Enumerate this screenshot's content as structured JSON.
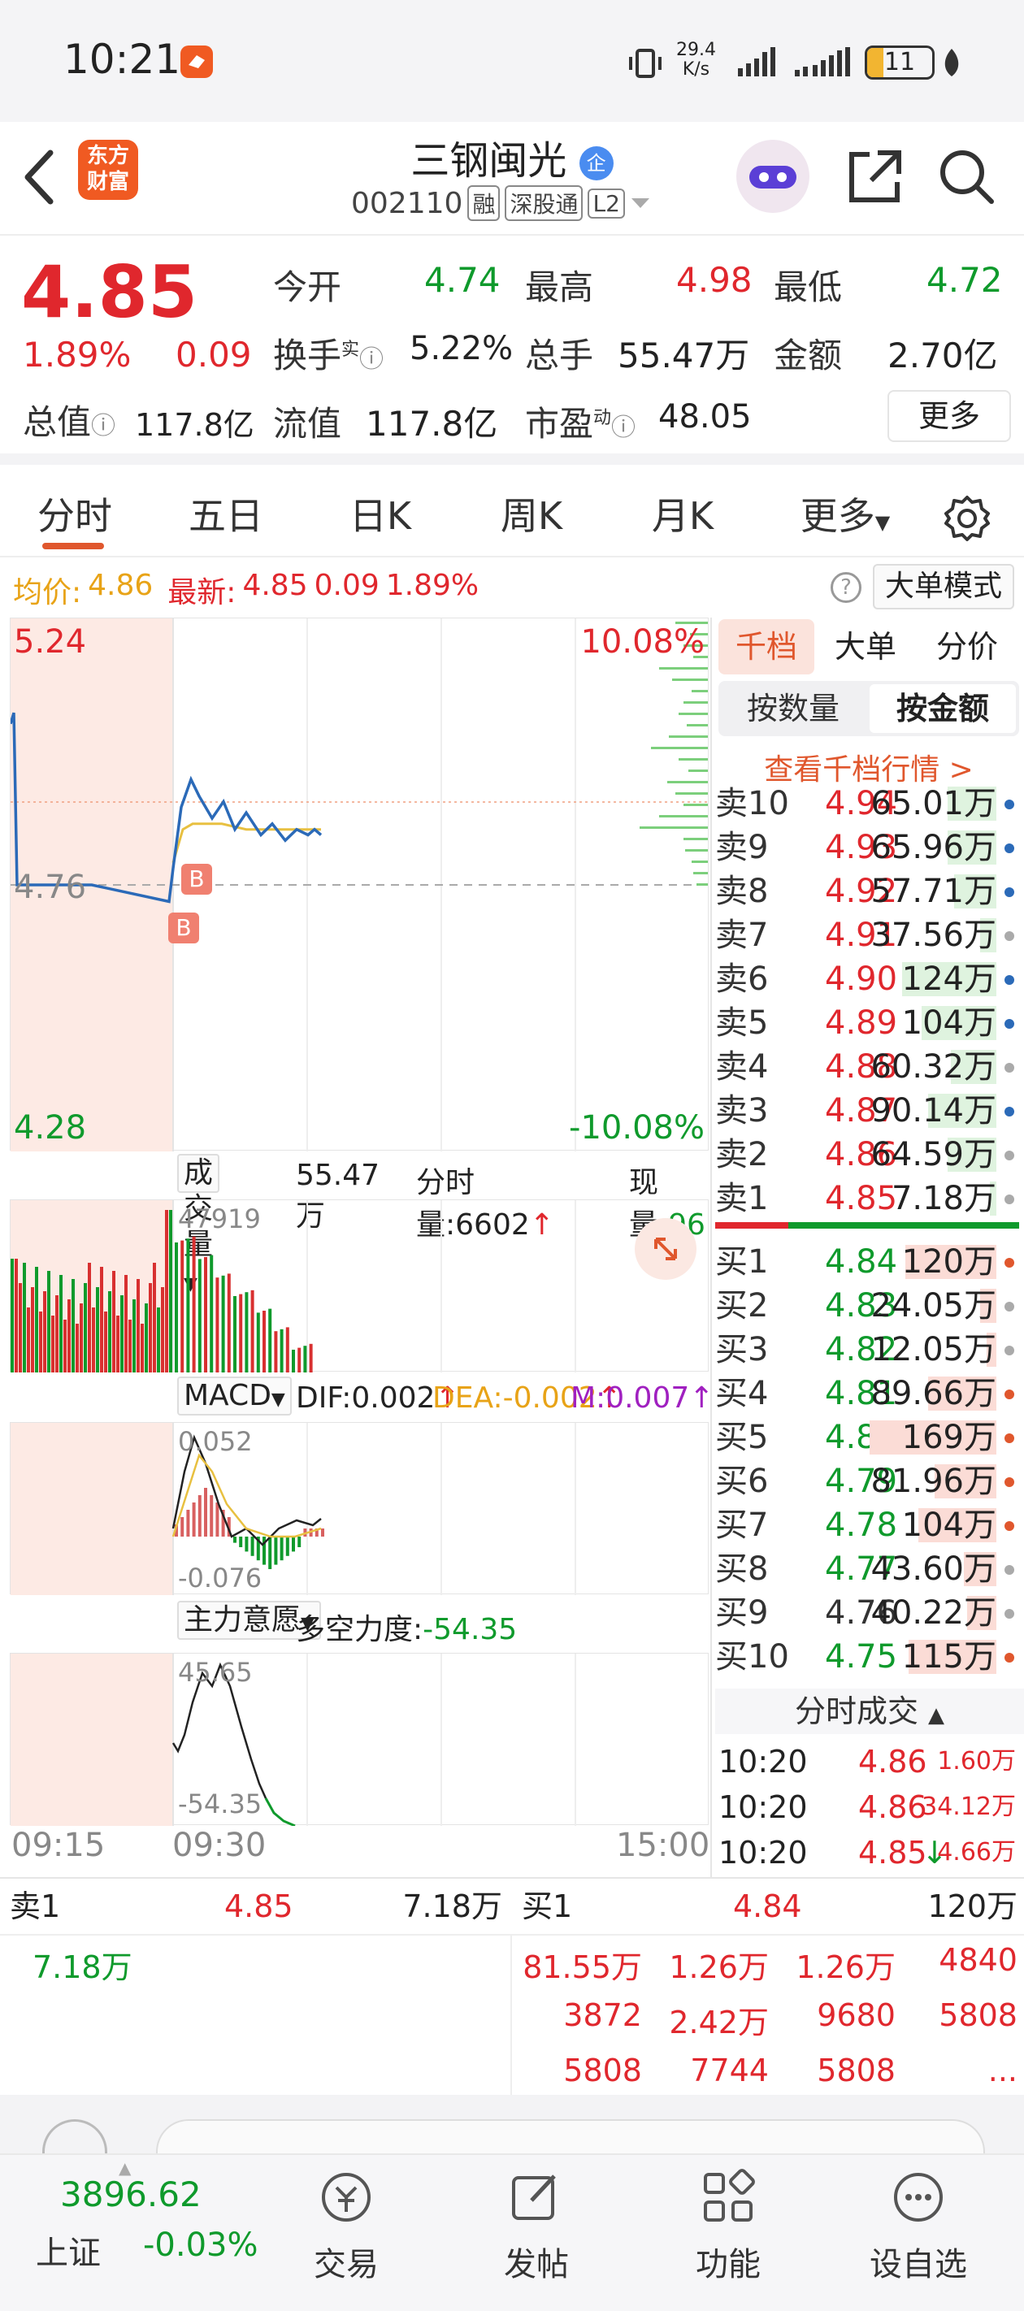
{
  "status_bar": {
    "time": "10:21",
    "net_speed_value": "29.4",
    "net_speed_unit": "K/s",
    "battery": "11"
  },
  "header": {
    "title": "三钢闽光",
    "title_badge": "企",
    "code": "002110",
    "tags": [
      "融",
      "深股通",
      "L2"
    ],
    "logo_line1": "东方",
    "logo_line2": "财富"
  },
  "quote": {
    "price": "4.85",
    "change_pct": "1.89%",
    "change": "0.09",
    "open_label": "今开",
    "open": "4.74",
    "high_label": "最高",
    "high": "4.98",
    "low_label": "最低",
    "low": "4.72",
    "turnover_label": "换手",
    "turnover_sup": "实",
    "turnover": "5.22%",
    "volume_label": "总手",
    "volume": "55.47万",
    "amount_label": "金额",
    "amount": "2.70亿",
    "mktcap_label": "总值",
    "mktcap": "117.8亿",
    "float_label": "流值",
    "float_cap": "117.8亿",
    "pe_label": "市盈",
    "pe_sup": "动",
    "pe": "48.05",
    "more_button": "更多"
  },
  "tabs": [
    "分时",
    "五日",
    "日K",
    "周K",
    "月K",
    "更多"
  ],
  "active_tab": 0,
  "avg_bar": {
    "avg_label": "均价:",
    "avg": "4.86",
    "latest_label": "最新:",
    "latest": "4.85",
    "change": "0.09",
    "change_pct": "1.89%",
    "mode_button": "大单模式"
  },
  "chart": {
    "y_max": "5.24",
    "y_mid": "4.76",
    "y_min": "4.28",
    "pct_max": "10.08%",
    "pct_min": "-10.08%",
    "time_start": "09:15",
    "time_open": "09:30",
    "time_end": "15:00",
    "buy_marker": "B"
  },
  "chart_data": {
    "type": "line",
    "title": "",
    "ylim": [
      4.28,
      5.24
    ],
    "x": [
      "09:15",
      "09:30",
      "15:00"
    ],
    "series": [
      {
        "values": [
          5.05,
          5.07,
          4.76,
          4.76,
          4.76,
          4.73,
          4.79,
          4.9,
          4.95,
          4.92,
          4.88,
          4.91,
          4.86,
          4.89,
          4.85,
          4.87,
          4.84,
          4.86,
          4.85,
          4.86,
          4.85
        ]
      },
      {
        "values": [
          4.8,
          4.86,
          4.87,
          4.87,
          4.87,
          4.86,
          4.86,
          4.86,
          4.86
        ]
      }
    ]
  },
  "volume_panel": {
    "label": "成交量",
    "total": "55.47万",
    "min_vol_label": "分时量:",
    "min_vol": "6602",
    "cur_label": "现量:",
    "cur": "96",
    "max_tick": "47919"
  },
  "macd_panel": {
    "label": "MACD",
    "dif": "DIF:0.002",
    "dea": "DEA:-0.002",
    "m": "M:0.007",
    "top_tick": "0.052",
    "bottom_tick": "-0.076"
  },
  "force_panel": {
    "label": "主力意愿",
    "index_label": "多空力度:",
    "index": "-54.35",
    "top_tick": "45.65",
    "bottom_tick": "-54.35"
  },
  "orderbook": {
    "tabs": [
      "千档",
      "大单",
      "分价"
    ],
    "subtabs": [
      "按数量",
      "按金额"
    ],
    "link": "查看千档行情 >",
    "asks": [
      {
        "label": "卖10",
        "price": "4.94",
        "vol": "65.01万",
        "bar": 0.3,
        "dot": "#2b6ab8"
      },
      {
        "label": "卖9",
        "price": "4.93",
        "vol": "65.96万",
        "bar": 0.3,
        "dot": "#2b6ab8"
      },
      {
        "label": "卖8",
        "price": "4.92",
        "vol": "57.71万",
        "bar": 0.26,
        "dot": "#2b6ab8"
      },
      {
        "label": "卖7",
        "price": "4.91",
        "vol": "37.56万",
        "bar": 0.1,
        "dot": "#aaaaaa"
      },
      {
        "label": "卖6",
        "price": "4.90",
        "vol": "124万",
        "bar": 0.58,
        "dot": "#2b6ab8"
      },
      {
        "label": "卖5",
        "price": "4.89",
        "vol": "104万",
        "bar": 0.46,
        "dot": "#2b6ab8"
      },
      {
        "label": "卖4",
        "price": "4.88",
        "vol": "60.32万",
        "bar": 0.28,
        "dot": "#aaaaaa"
      },
      {
        "label": "卖3",
        "price": "4.87",
        "vol": "90.14万",
        "bar": 0.42,
        "dot": "#2b6ab8"
      },
      {
        "label": "卖2",
        "price": "4.86",
        "vol": "64.59万",
        "bar": 0.3,
        "dot": "#aaaaaa"
      },
      {
        "label": "卖1",
        "price": "4.85",
        "vol": "7.18万",
        "bar": 0.04,
        "dot": "#aaaaaa"
      }
    ],
    "bids": [
      {
        "label": "买1",
        "price": "4.84",
        "vol": "120万",
        "bar": 0.56,
        "dot": "#e0572d"
      },
      {
        "label": "买2",
        "price": "4.83",
        "vol": "24.05万",
        "bar": 0.1,
        "dot": "#aaaaaa"
      },
      {
        "label": "买3",
        "price": "4.82",
        "vol": "12.05万",
        "bar": 0.06,
        "dot": "#aaaaaa"
      },
      {
        "label": "买4",
        "price": "4.81",
        "vol": "89.66万",
        "bar": 0.42,
        "dot": "#e0572d"
      },
      {
        "label": "买5",
        "price": "4.80",
        "vol": "169万",
        "bar": 0.78,
        "dot": "#e0572d"
      },
      {
        "label": "买6",
        "price": "4.79",
        "vol": "81.96万",
        "bar": 0.38,
        "dot": "#e0572d"
      },
      {
        "label": "买7",
        "price": "4.78",
        "vol": "104万",
        "bar": 0.48,
        "dot": "#e0572d"
      },
      {
        "label": "买8",
        "price": "4.77",
        "vol": "43.60万",
        "bar": 0.2,
        "dot": "#aaaaaa"
      },
      {
        "label": "买9",
        "price": "4.76",
        "vol": "40.22万",
        "bar": 0.18,
        "dot": "#aaaaaa"
      },
      {
        "label": "买10",
        "price": "4.75",
        "vol": "115万",
        "bar": 0.54,
        "dot": "#e0572d"
      }
    ],
    "trades_title": "分时成交",
    "trades": [
      {
        "time": "10:20",
        "price": "4.86",
        "vol": "1.60万",
        "arrow": ""
      },
      {
        "time": "10:20",
        "price": "4.86",
        "vol": "34.12万",
        "arrow": ""
      },
      {
        "time": "10:20",
        "price": "4.85",
        "vol": "4.66万",
        "arrow": "↓"
      }
    ]
  },
  "queue": {
    "sell_label": "卖1",
    "sell_price": "4.85",
    "sell_vol": "7.18万",
    "buy_label": "买1",
    "buy_price": "4.84",
    "buy_vol": "120万",
    "sell_items": [
      "7.18万"
    ],
    "buy_items": [
      "81.55万",
      "1.26万",
      "1.26万",
      "4840",
      "3872",
      "2.42万",
      "9680",
      "5808",
      "5808",
      "7744",
      "5808",
      "..."
    ]
  },
  "bottom_nav": {
    "index_value": "3896.62",
    "index_name": "上证",
    "index_change": "-0.03%",
    "items": [
      "交易",
      "发帖",
      "功能",
      "设自选"
    ]
  }
}
